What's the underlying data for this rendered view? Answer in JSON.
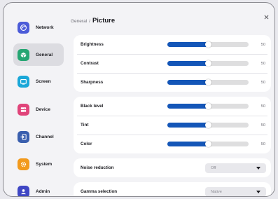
{
  "sidebar": {
    "items": [
      {
        "label": "Network",
        "icon": "network-icon",
        "color": "#4b5bd8",
        "active": false
      },
      {
        "label": "General",
        "icon": "general-icon",
        "color": "#26a673",
        "active": true
      },
      {
        "label": "Screen",
        "icon": "screen-icon",
        "color": "#1aa7d8",
        "active": false
      },
      {
        "label": "Device",
        "icon": "device-icon",
        "color": "#e0447a",
        "active": false
      },
      {
        "label": "Channel",
        "icon": "channel-icon",
        "color": "#3a5fae",
        "active": false
      },
      {
        "label": "System",
        "icon": "system-icon",
        "color": "#f29a1d",
        "active": false
      },
      {
        "label": "Admin",
        "icon": "admin-icon",
        "color": "#3f47c4",
        "active": false
      }
    ]
  },
  "header": {
    "breadcrumb_parent": "General",
    "separator": "/",
    "title": "Picture",
    "close_icon": "close-icon"
  },
  "picture_settings": {
    "group1": [
      {
        "label": "Brightness",
        "value": "50",
        "level": 0.5
      },
      {
        "label": "Contrast",
        "value": "50",
        "level": 0.5
      },
      {
        "label": "Sharpness",
        "value": "50",
        "level": 0.5
      }
    ],
    "group2": [
      {
        "label": "Black level",
        "value": "50",
        "level": 0.5
      },
      {
        "label": "Tint",
        "value": "50",
        "level": 0.5
      },
      {
        "label": "Color",
        "value": "50",
        "level": 0.5
      }
    ],
    "noise_reduction": {
      "label": "Noise reduction",
      "value": "Off"
    },
    "gamma_selection": {
      "label": "Gamma selection",
      "value": "Native"
    }
  },
  "colors": {
    "accent": "#1456b8",
    "track": "#dededf",
    "background": "#f3f3f6",
    "card": "#ffffff"
  }
}
